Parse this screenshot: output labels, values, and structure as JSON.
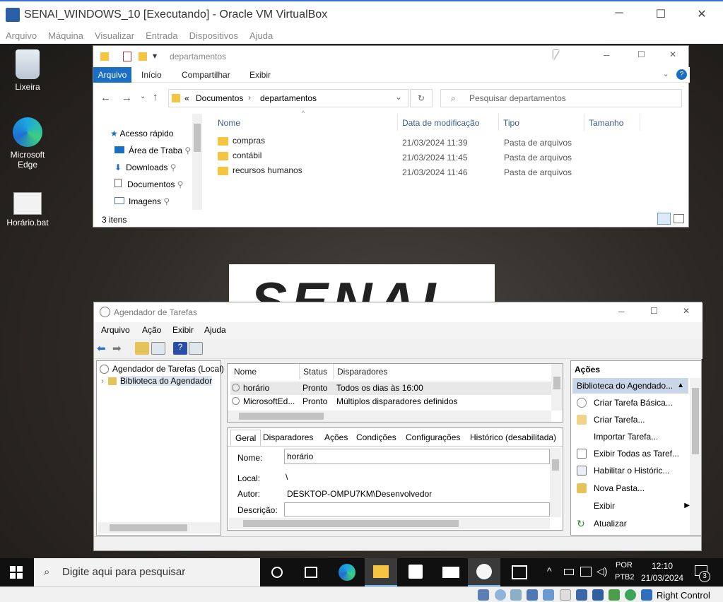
{
  "vbox": {
    "title": "SENAI_WINDOWS_10 [Executando] - Oracle VM VirtualBox",
    "menu": [
      "Arquivo",
      "Máquina",
      "Visualizar",
      "Entrada",
      "Dispositivos",
      "Ajuda"
    ],
    "status_right": "Right Control"
  },
  "desktop": {
    "icons": [
      {
        "label": "Lixeira",
        "icon": "recycle-bin-icon"
      },
      {
        "label": "Microsoft\nEdge",
        "icon": "edge-icon"
      },
      {
        "label": "Horário.bat",
        "icon": "batch-file-icon"
      }
    ],
    "wallpaper_text": "SENAI"
  },
  "explorer": {
    "title": "departamentos",
    "ribbon": [
      "Arquivo",
      "Início",
      "Compartilhar",
      "Exibir"
    ],
    "breadcrumb_prefix": "«",
    "breadcrumb": [
      "Documentos",
      "departamentos"
    ],
    "search_placeholder": "Pesquisar departamentos",
    "nav": [
      {
        "label": "Acesso rápido",
        "icon": "star-icon"
      },
      {
        "label": "Área de Traba",
        "icon": "desktop-icon",
        "pinned": true
      },
      {
        "label": "Downloads",
        "icon": "download-icon",
        "pinned": true
      },
      {
        "label": "Documentos",
        "icon": "documents-icon",
        "pinned": true
      },
      {
        "label": "Imagens",
        "icon": "pictures-icon",
        "pinned": true
      }
    ],
    "columns": [
      "Nome",
      "Data de modificação",
      "Tipo",
      "Tamanho"
    ],
    "files": [
      {
        "name": "compras",
        "date": "21/03/2024 11:39",
        "type": "Pasta de arquivos"
      },
      {
        "name": "contábil",
        "date": "21/03/2024 11:45",
        "type": "Pasta de arquivos"
      },
      {
        "name": "recursos humanos",
        "date": "21/03/2024 11:46",
        "type": "Pasta de arquivos"
      }
    ],
    "status": "3 itens"
  },
  "scheduler": {
    "title": "Agendador de Tarefas",
    "menu": [
      "Arquivo",
      "Ação",
      "Exibir",
      "Ajuda"
    ],
    "tree": [
      "Agendador de Tarefas (Local)",
      "Biblioteca do Agendador"
    ],
    "columns": [
      "Nome",
      "Status",
      "Disparadores"
    ],
    "tasks": [
      {
        "name": "horário",
        "status": "Pronto",
        "trigger": "Todos os dias às 16:00"
      },
      {
        "name": "MicrosoftEd...",
        "status": "Pronto",
        "trigger": "Múltiplos disparadores definidos"
      }
    ],
    "tabs": [
      "Geral",
      "Disparadores",
      "Ações",
      "Condições",
      "Configurações",
      "Histórico (desabilitada)"
    ],
    "detail": {
      "name_label": "Nome:",
      "name_value": "horário",
      "local_label": "Local:",
      "local_value": "\\",
      "author_label": "Autor:",
      "author_value": "DESKTOP-OMPU7KM\\Desenvolvedor",
      "desc_label": "Descrição:"
    },
    "actions_header": "Ações",
    "actions_section": "Biblioteca do Agendado...",
    "actions": [
      "Criar Tarefa Básica...",
      "Criar Tarefa...",
      "Importar Tarefa...",
      "Exibir Todas as Taref...",
      "Habilitar o Históric...",
      "Nova Pasta...",
      "Exibir",
      "Atualizar"
    ]
  },
  "taskbar": {
    "search_placeholder": "Digite aqui para pesquisar",
    "lang1": "POR",
    "lang2": "PTB2",
    "time": "12:10",
    "date": "21/03/2024",
    "notif_count": "3"
  }
}
